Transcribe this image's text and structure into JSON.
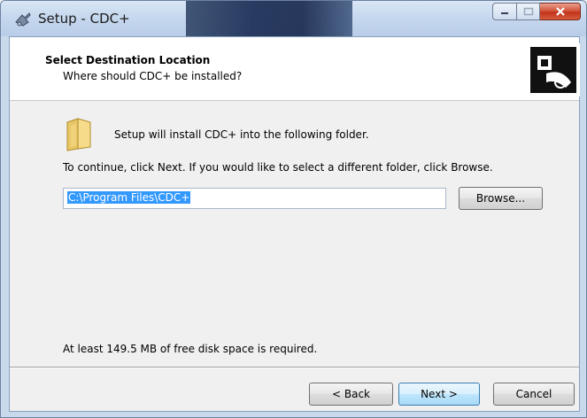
{
  "window": {
    "title": "Setup - CDC+"
  },
  "header": {
    "title": "Select Destination Location",
    "subtitle": "Where should CDC+ be installed?"
  },
  "body": {
    "install_text": "Setup will install CDC+ into the following folder.",
    "continue_text": "To continue, click Next. If you would like to select a different folder, click Browse.",
    "path_value": "C:\\Program Files\\CDC+",
    "browse_label": "Browse...",
    "disk_space_text": "At least 149.5 MB of free disk space is required."
  },
  "footer": {
    "back_label": "< Back",
    "next_label": "Next >",
    "cancel_label": "Cancel"
  },
  "icons": {
    "title": "setup-app-icon",
    "folder": "folder-icon",
    "logo": "installer-logo-icon",
    "minimize": "minimize-icon",
    "maximize": "maximize-icon",
    "close": "close-icon"
  }
}
